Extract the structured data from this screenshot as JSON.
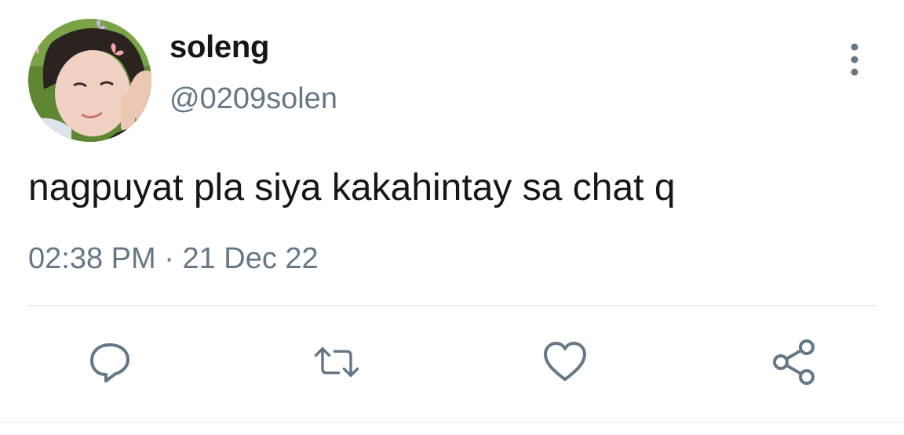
{
  "tweet": {
    "display_name": "soleng",
    "handle": "@0209solen",
    "text": "nagpuyat pla siya kakahintay sa chat q",
    "time": "02:38 PM",
    "separator": "·",
    "date": "21 Dec 22"
  },
  "icons": {
    "more": "more-vertical-icon",
    "reply": "reply-icon",
    "retweet": "retweet-icon",
    "like": "heart-icon",
    "share": "share-icon"
  },
  "colors": {
    "primary_text": "#14171a",
    "secondary_text": "#657786",
    "divider": "#e6ecf0"
  }
}
